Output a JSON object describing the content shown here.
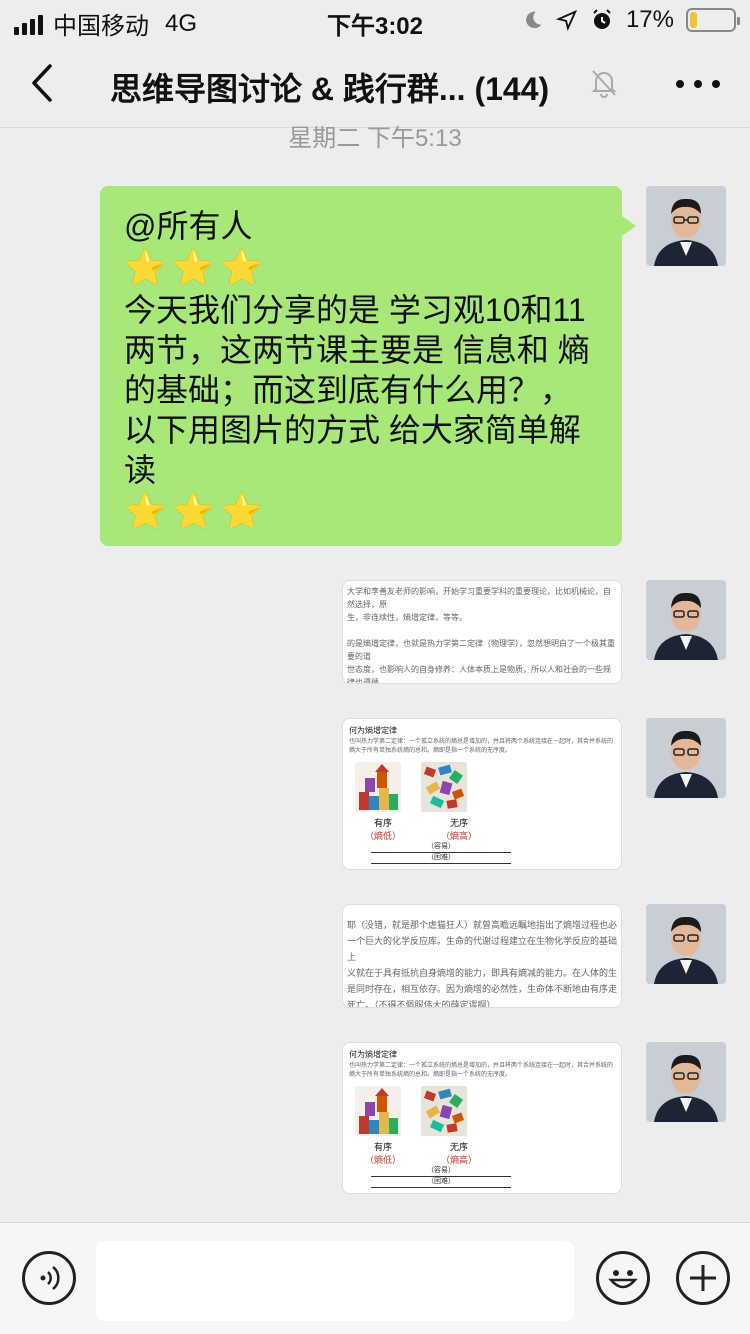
{
  "status_bar": {
    "carrier": "中国移动",
    "network": "4G",
    "time": "下午3:02",
    "battery_percent": "17%",
    "battery_level": 0.17
  },
  "nav": {
    "title": "思维导图讨论 & 践行群... (144)"
  },
  "timestamp": "星期二 下午5:13",
  "message": {
    "line1": "@所有人",
    "stars": "⭐⭐⭐",
    "line2": "今天我们分享的是 学习观10和11两节，这两节课主要是 信息和 熵的基础；而这到底有什么用？，以下用图片的方式 给大家简单解读",
    "stars2": "⭐⭐⭐"
  },
  "images": [
    {
      "text": "大学和李善友老师的影响，开始学习重要学科的重要理论，比如机械论，自然选择，原\n生，非连续性，熵增定律，等等。\n\n的是熵增定律，也就是热力学第二定律（物理学），忽然想明白了一个极其重要的道\n世态度，也影响人的自身修养：人体本质上是物质，所以人和社会的一些规律也遵循\n律。"
    },
    {
      "title": "何为熵增定律",
      "body": "也叫热力学第二定律：一个孤立系统的熵总是增加的，并且将两个系统连接在一起时，其合并系统的熵大于所有单独系统熵的总和。熵即是指一个系统的无序度。",
      "ordered": "有序",
      "ordered_sub": "（熵低）",
      "disordered": "无序",
      "disordered_sub": "（熵高）",
      "easy": "（容易）",
      "hard": "（困难）"
    },
    {
      "text": "耶（没错，就是那个虐猫狂人）就曾高瞻远瞩地指出了熵增过程也必\n一个巨大的化学反应库。生命的代谢过程建立在生物化学反应的基础上\n义就在于具有抵抗自身熵增的能力，即具有熵减的能力。在人体的生\n是同时存在，相互依存。因为熵增的必然性，生命体不断地由有序走\n死亡。（不得不佩服伟大的薛定谔啊）"
    },
    {
      "title": "何为熵增定律",
      "body": "也叫热力学第二定律：一个孤立系统的熵总是增加的，并且将两个系统连接在一起时，其合并系统的熵大于所有单独系统熵的总和。熵即是指一个系统的无序度。",
      "ordered": "有序",
      "ordered_sub": "（熵低）",
      "disordered": "无序",
      "disordered_sub": "（熵高）",
      "easy": "（容易）",
      "hard": "（困难）"
    }
  ],
  "colors": {
    "bubble_green": "#a8e879",
    "background": "#ededed",
    "battery_yellow": "#f2c230"
  },
  "icons": [
    "back-arrow-icon",
    "mute-bell-icon",
    "more-icon",
    "voice-icon",
    "emoji-icon",
    "plus-icon"
  ]
}
